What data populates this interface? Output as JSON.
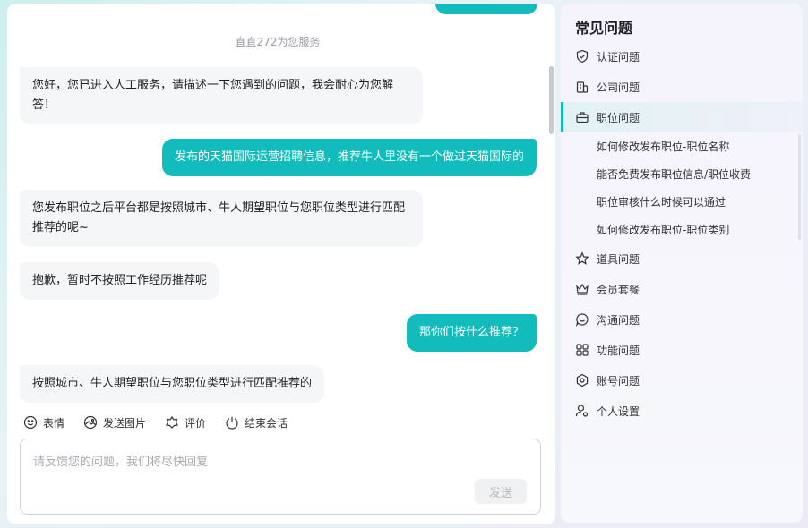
{
  "chat": {
    "system_note": "直直272为您服务",
    "messages": [
      {
        "role": "agent",
        "text": "您好，您已进入人工服务，请描述一下您遇到的问题，我会耐心为您解答！"
      },
      {
        "role": "user",
        "text": "发布的天猫国际运营招聘信息，推荐牛人里没有一个做过天猫国际的"
      },
      {
        "role": "agent",
        "text": "您发布职位之后平台都是按照城市、牛人期望职位与您职位类型进行匹配推荐的呢~"
      },
      {
        "role": "agent",
        "text": "抱歉，暂时不按照工作经历推荐呢"
      },
      {
        "role": "user",
        "text": "那你们按什么推荐？"
      },
      {
        "role": "agent",
        "text": "按照城市、牛人期望职位与您职位类型进行匹配推荐的"
      }
    ],
    "toolbar": {
      "emoji": "表情",
      "image": "发送图片",
      "rate": "评价",
      "end": "结束会话"
    },
    "input": {
      "placeholder": "请反馈您的问题，我们将尽快回复",
      "value": ""
    },
    "send_label": "发送"
  },
  "faq": {
    "title": "常见问题",
    "items": [
      {
        "label": "认证问题",
        "icon": "shield-check-icon"
      },
      {
        "label": "公司问题",
        "icon": "building-icon"
      },
      {
        "label": "职位问题",
        "icon": "briefcase-icon",
        "active": true
      },
      {
        "label": "道具问题",
        "icon": "star-outline-icon"
      },
      {
        "label": "会员套餐",
        "icon": "crown-icon"
      },
      {
        "label": "沟通问题",
        "icon": "chat-bubble-icon"
      },
      {
        "label": "功能问题",
        "icon": "grid-icon"
      },
      {
        "label": "账号问题",
        "icon": "hexagon-icon"
      },
      {
        "label": "个人设置",
        "icon": "person-gear-icon"
      }
    ],
    "sub_items": [
      "如何修改发布职位-职位名称",
      "能否免费发布职位信息/职位收费",
      "职位审核什么时候可以通过",
      "如何修改发布职位-职位类别"
    ]
  },
  "colors": {
    "accent": "#12bcbc",
    "agent_bubble": "#f5f6f8",
    "muted_text": "#9a9da3"
  }
}
